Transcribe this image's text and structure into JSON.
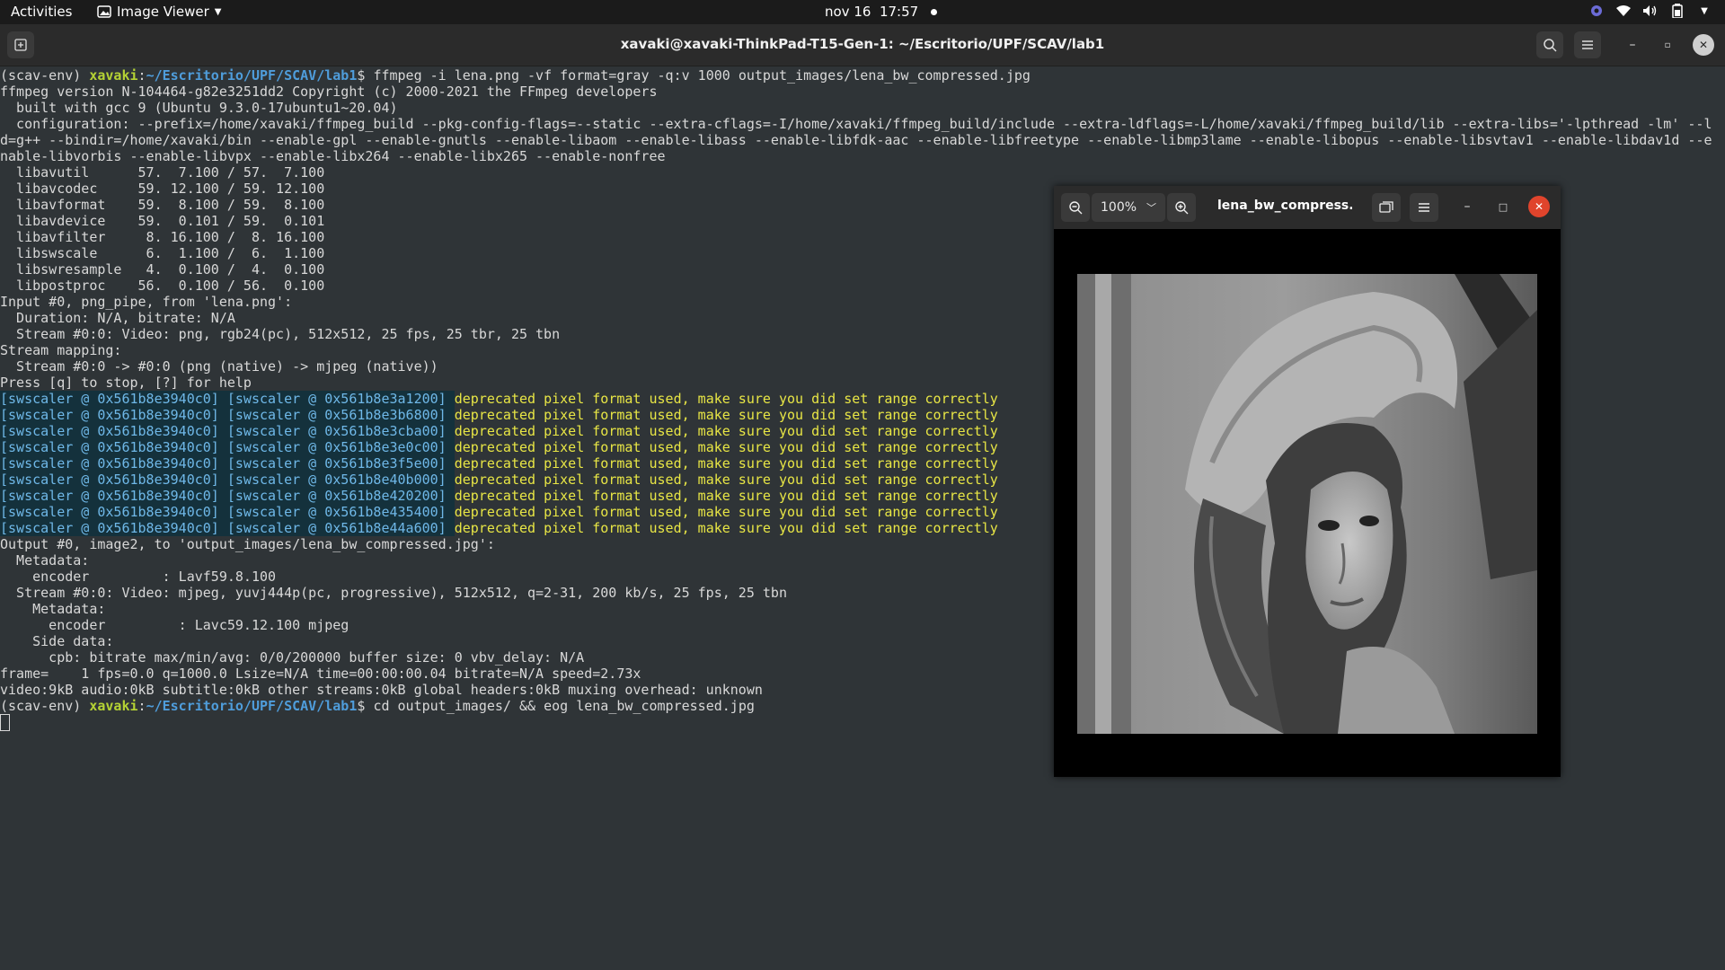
{
  "topbar": {
    "activities": "Activities",
    "app_menu": "Image Viewer",
    "date": "nov 16",
    "time": "17:57"
  },
  "terminal": {
    "title": "xavaki@xavaki-ThinkPad-T15-Gen-1: ~/Escritorio/UPF/SCAV/lab1",
    "prompt_env": "(scav-env) ",
    "prompt_user": "xavaki",
    "prompt_path": "~/Escritorio/UPF/SCAV/lab1",
    "commands": [
      "ffmpeg -i lena.png -vf format=gray -q:v 1000 output_images/lena_bw_compressed.jpg",
      "cd output_images/ && eog lena_bw_compressed.jpg"
    ],
    "output_lines": [
      "ffmpeg version N-104464-g82e3251dd2 Copyright (c) 2000-2021 the FFmpeg developers",
      "  built with gcc 9 (Ubuntu 9.3.0-17ubuntu1~20.04)",
      "  configuration: --prefix=/home/xavaki/ffmpeg_build --pkg-config-flags=--static --extra-cflags=-I/home/xavaki/ffmpeg_build/include --extra-ldflags=-L/home/xavaki/ffmpeg_build/lib --extra-libs='-lpthread -lm' --l",
      "d=g++ --bindir=/home/xavaki/bin --enable-gpl --enable-gnutls --enable-libaom --enable-libass --enable-libfdk-aac --enable-libfreetype --enable-libmp3lame --enable-libopus --enable-libsvtav1 --enable-libdav1d --e",
      "nable-libvorbis --enable-libvpx --enable-libx264 --enable-libx265 --enable-nonfree",
      "  libavutil      57.  7.100 / 57.  7.100",
      "  libavcodec     59. 12.100 / 59. 12.100",
      "  libavformat    59.  8.100 / 59.  8.100",
      "  libavdevice    59.  0.101 / 59.  0.101",
      "  libavfilter     8. 16.100 /  8. 16.100",
      "  libswscale      6.  1.100 /  6.  1.100",
      "  libswresample   4.  0.100 /  4.  0.100",
      "  libpostproc    56.  0.100 / 56.  0.100",
      "Input #0, png_pipe, from 'lena.png':",
      "  Duration: N/A, bitrate: N/A",
      "  Stream #0:0: Video: png, rgb24(pc), 512x512, 25 fps, 25 tbr, 25 tbn",
      "Stream mapping:",
      "  Stream #0:0 -> #0:0 (png (native) -> mjpeg (native))",
      "Press [q] to stop, [?] for help"
    ],
    "swscaler_lines": [
      "[swscaler @ 0x561b8e3940c0] [swscaler @ 0x561b8e3a1200]",
      "[swscaler @ 0x561b8e3940c0] [swscaler @ 0x561b8e3b6800]",
      "[swscaler @ 0x561b8e3940c0] [swscaler @ 0x561b8e3cba00]",
      "[swscaler @ 0x561b8e3940c0] [swscaler @ 0x561b8e3e0c00]",
      "[swscaler @ 0x561b8e3940c0] [swscaler @ 0x561b8e3f5e00]",
      "[swscaler @ 0x561b8e3940c0] [swscaler @ 0x561b8e40b000]",
      "[swscaler @ 0x561b8e3940c0] [swscaler @ 0x561b8e420200]",
      "[swscaler @ 0x561b8e3940c0] [swscaler @ 0x561b8e435400]",
      "[swscaler @ 0x561b8e3940c0] [swscaler @ 0x561b8e44a600]"
    ],
    "warning_text": "deprecated pixel format used, make sure you did set range correctly",
    "output_lines_2": [
      "Output #0, image2, to 'output_images/lena_bw_compressed.jpg':",
      "  Metadata:",
      "    encoder         : Lavf59.8.100",
      "  Stream #0:0: Video: mjpeg, yuvj444p(pc, progressive), 512x512, q=2-31, 200 kb/s, 25 fps, 25 tbn",
      "    Metadata:",
      "      encoder         : Lavc59.12.100 mjpeg",
      "    Side data:",
      "      cpb: bitrate max/min/avg: 0/0/200000 buffer size: 0 vbv_delay: N/A",
      "frame=    1 fps=0.0 q=1000.0 Lsize=N/A time=00:00:00.04 bitrate=N/A speed=2.73x",
      "video:9kB audio:0kB subtitle:0kB other streams:0kB global headers:0kB muxing overhead: unknown"
    ]
  },
  "viewer": {
    "zoom": "100%",
    "title": "lena_bw_compress..."
  },
  "icons": {
    "new_tab": "new-tab-icon",
    "search": "search-icon",
    "menu": "hamburger-menu-icon",
    "zoom_out": "zoom-out-icon",
    "zoom_in": "zoom-in-icon",
    "close": "close-icon"
  },
  "colors": {
    "prompt_user": "#b5d334",
    "prompt_path": "#4f9ddb",
    "warning": "#e8e645",
    "swscaler_bg": "#14313c",
    "close_red": "#e0442c"
  }
}
